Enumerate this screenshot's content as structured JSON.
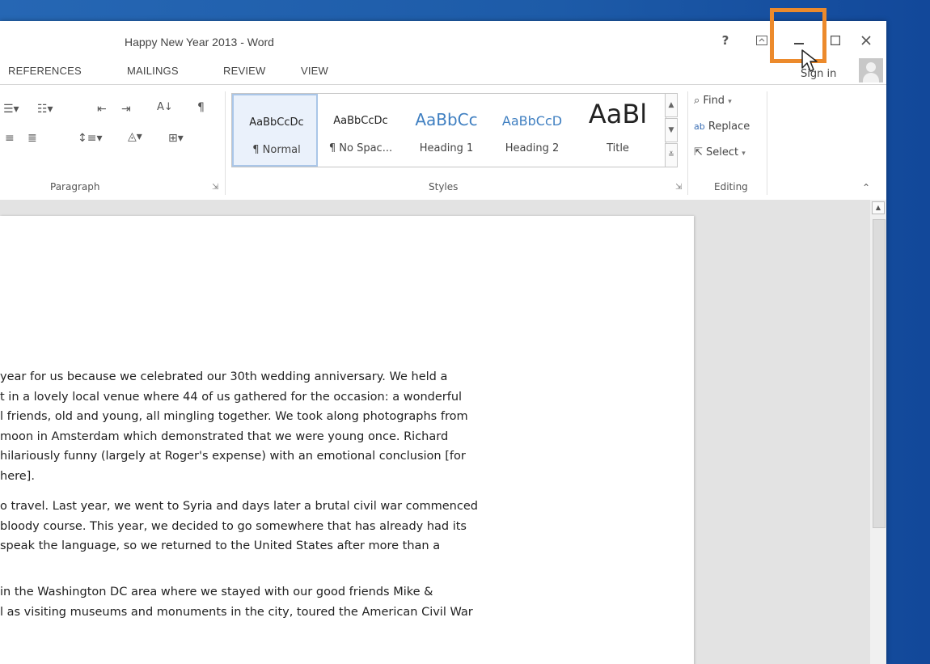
{
  "window": {
    "title": "Happy New Year 2013 - Word",
    "help_label": "?",
    "ribbon_display_icon": "ribbon-display-icon",
    "minimize_icon": "minimize-icon",
    "maximize_icon": "maximize-icon",
    "close_icon": "close-icon"
  },
  "tabs": [
    "REFERENCES",
    "MAILINGS",
    "REVIEW",
    "VIEW"
  ],
  "account": {
    "signin_label": "Sign in"
  },
  "ribbon": {
    "paragraph_label": "Paragraph",
    "styles_label": "Styles",
    "editing_label": "Editing",
    "styles": [
      {
        "preview": "AaBbCcDc",
        "name": "¶ Normal"
      },
      {
        "preview": "AaBbCcDc",
        "name": "¶ No Spac..."
      },
      {
        "preview": "AaBbCc",
        "name": "Heading 1"
      },
      {
        "preview": "AaBbCcD",
        "name": "Heading 2"
      },
      {
        "preview": "AaBl",
        "name": "Title"
      }
    ],
    "editing": {
      "find": "Find",
      "replace": "Replace",
      "select": "Select"
    }
  },
  "document": {
    "paragraphs": [
      [
        "year for us because we celebrated our 30th wedding anniversary. We held a",
        "t in a lovely local venue where 44 of us gathered for the occasion: a wonderful",
        "l friends, old and young, all mingling together. We took along photographs from",
        "moon in Amsterdam which demonstrated that we were young once. Richard",
        "hilariously funny (largely at Roger's expense) with an emotional conclusion [for",
        "here]."
      ],
      [
        "o travel. Last year, we went to Syria and days later a brutal civil war commenced",
        " bloody course. This year, we decided to go somewhere that has already had its",
        "speak the language, so we returned to the United States after more than a"
      ],
      [
        " in the Washington DC area where we stayed with our good friends Mike &",
        "l as visiting museums and monuments in the city, toured the American Civil War"
      ]
    ]
  },
  "colors": {
    "highlight": "#ec8a2c",
    "desktop": "#1d5ba8"
  }
}
